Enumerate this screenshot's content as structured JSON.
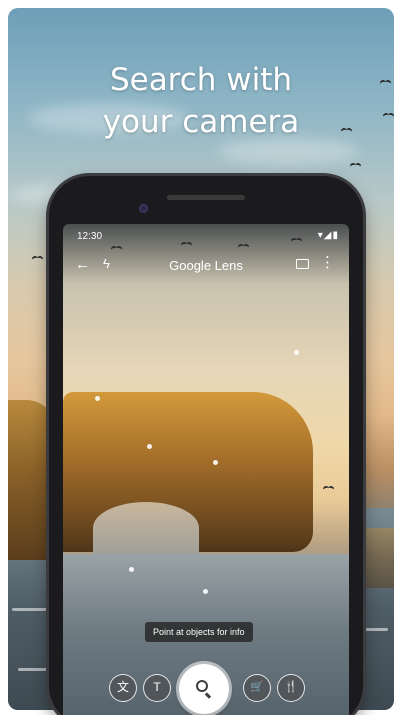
{
  "promo": {
    "headline_line1": "Search with",
    "headline_line2": "your camera"
  },
  "status_bar": {
    "time": "12:30",
    "icons": "▾◢▮"
  },
  "lens_bar": {
    "back_icon": "←",
    "flash_icon": "ϟ",
    "title": "Google Lens",
    "more_icon": "⋮"
  },
  "hint_chip": {
    "text": "Point at objects for info"
  },
  "modes": {
    "translate": "文",
    "text": "T",
    "search": "search",
    "shopping": "🛒",
    "dining": "🍴"
  },
  "colors": {
    "sky_top": "#6d9fb8",
    "rock": "#d39a3b",
    "shutter": "#ffffff",
    "phone_frame": "#1b1b1d"
  }
}
